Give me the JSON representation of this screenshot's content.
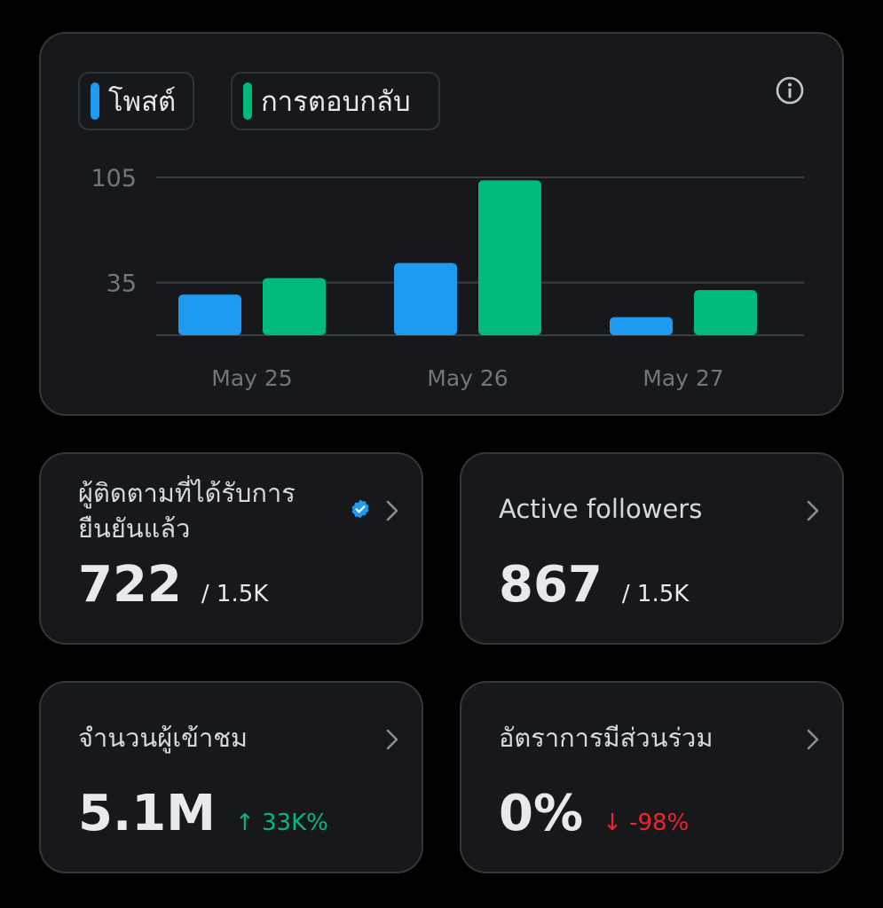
{
  "chart": {
    "legend": {
      "posts_label": "โพสต์",
      "replies_label": "การตอบกลับ"
    },
    "colors": {
      "posts": "#1d9bf0",
      "replies": "#00ba7c",
      "grid": "#3a3d42",
      "tick": "#71767b"
    },
    "info_icon": "info-icon"
  },
  "chart_data": {
    "type": "bar",
    "categories": [
      "May 25",
      "May 26",
      "May 27"
    ],
    "series": [
      {
        "name": "โพสต์",
        "values": [
          27,
          48,
          12
        ]
      },
      {
        "name": "การตอบกลับ",
        "values": [
          38,
          103,
          30
        ]
      }
    ],
    "y_ticks": [
      35,
      105
    ],
    "ylim": [
      0,
      105
    ],
    "grid": true,
    "legend": "top-left"
  },
  "stats": {
    "verified": {
      "label_line1": "ผู้ติดตามที่ได้รับการ",
      "label_line2": "ยืนยันแล้ว",
      "value": "722",
      "sub": "/ 1.5K",
      "badge_icon": "verified-badge-icon"
    },
    "active": {
      "label": "Active followers",
      "value": "867",
      "sub": "/ 1.5K"
    },
    "impressions": {
      "label": "จำนวนผู้เข้าชม",
      "value": "5.1M",
      "change": "↑ 33K%"
    },
    "engagement": {
      "label": "อัตราการมีส่วนร่วม",
      "value": "0%",
      "change": "↓ -98%"
    }
  }
}
